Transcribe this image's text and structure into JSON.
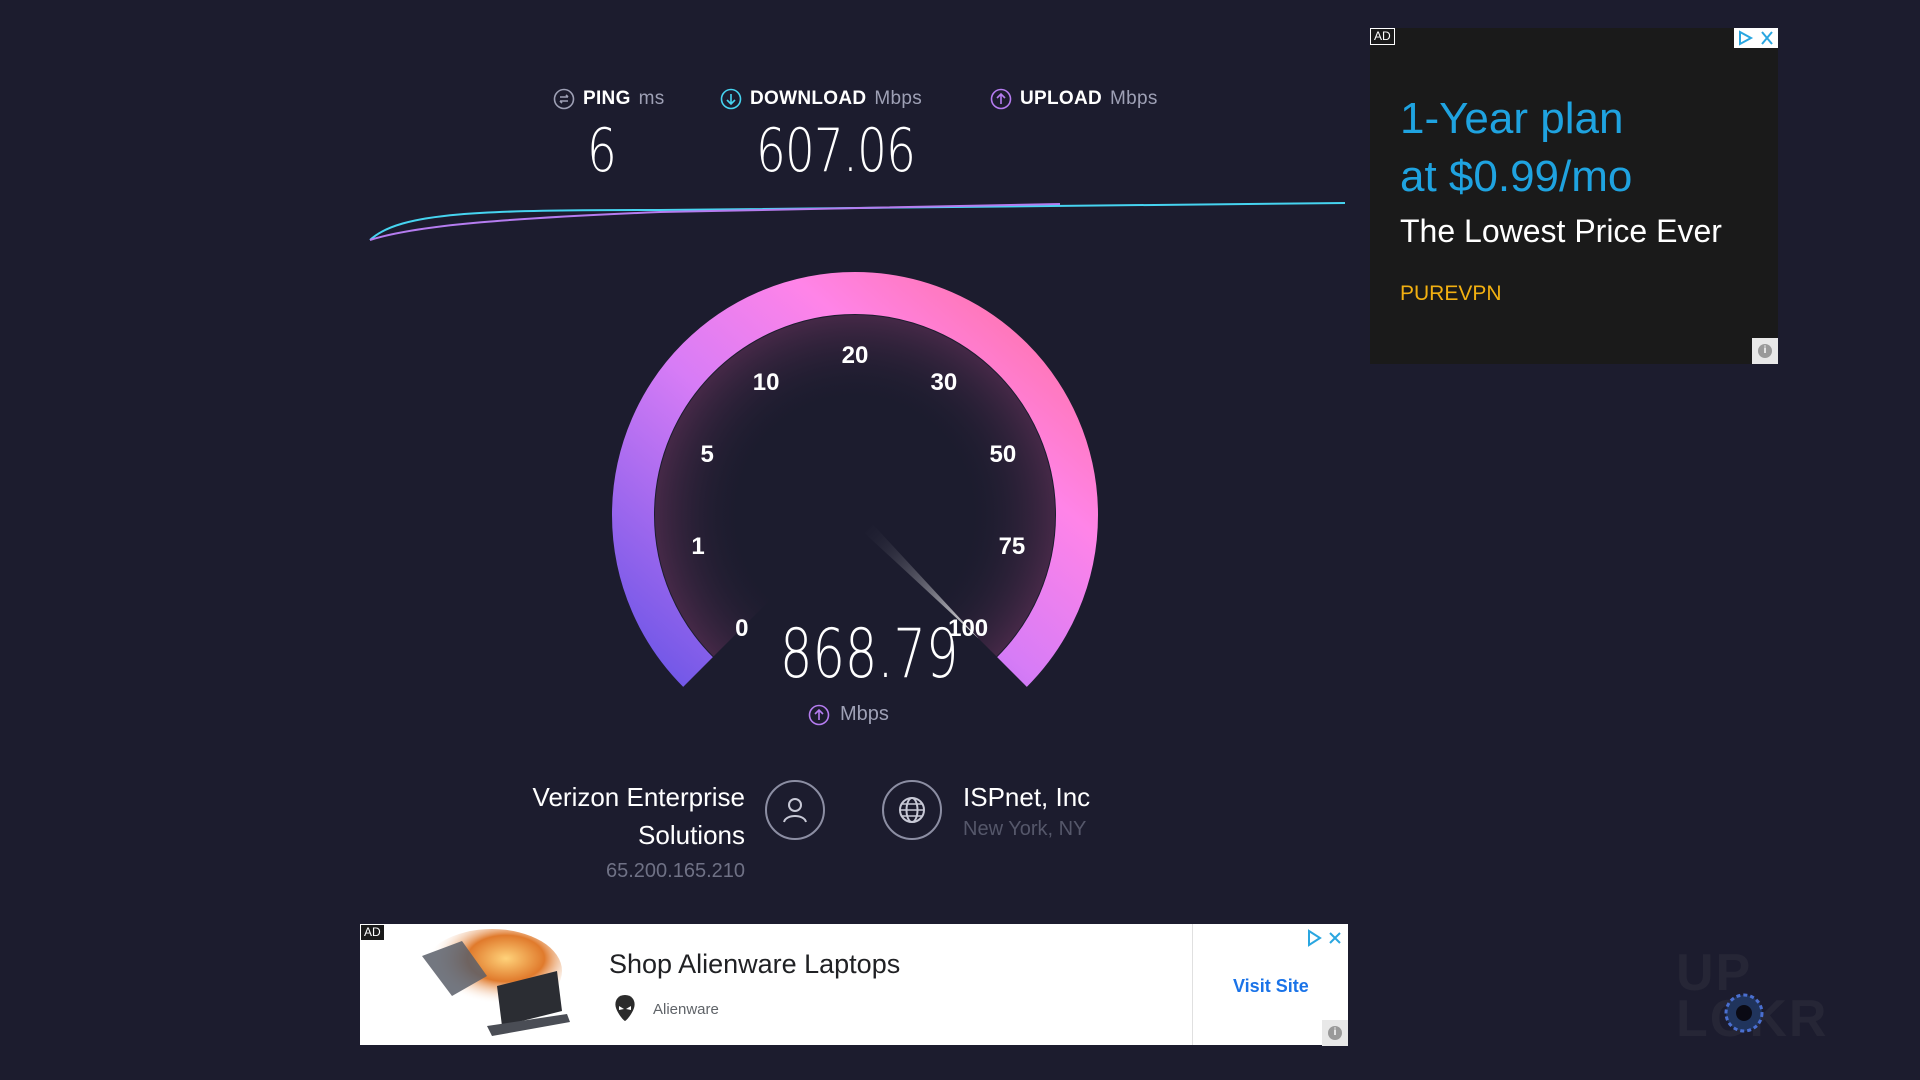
{
  "results": {
    "ping": {
      "label": "PING",
      "unit": "ms",
      "value": "6"
    },
    "download": {
      "label": "DOWNLOAD",
      "unit": "Mbps",
      "value": "607.06"
    },
    "upload": {
      "label": "UPLOAD",
      "unit": "Mbps"
    }
  },
  "gauge": {
    "ticks": [
      "0",
      "1",
      "5",
      "10",
      "20",
      "30",
      "50",
      "75",
      "100"
    ],
    "reading": "868.79",
    "unit": "Mbps",
    "colors": {
      "start": "#7b5cf0",
      "mid": "#ff7cf0",
      "end": "#ff6f9c"
    }
  },
  "client": {
    "isp": "Verizon Enterprise Solutions",
    "ip": "65.200.165.210"
  },
  "server": {
    "name": "ISPnet, Inc",
    "location": "New York, NY"
  },
  "ad_right": {
    "badge": "AD",
    "headline_1": "1-Year plan",
    "headline_2": "at $0.99/mo",
    "subline": "The Lowest Price Ever",
    "brand": "PUREVPN"
  },
  "ad_bottom": {
    "badge": "AD",
    "title": "Shop Alienware Laptops",
    "advertiser": "Alienware",
    "cta": "Visit Site"
  },
  "colors": {
    "background": "#1c1c2e",
    "download_accent": "#46d4f0",
    "upload_accent": "#b57cf0"
  }
}
